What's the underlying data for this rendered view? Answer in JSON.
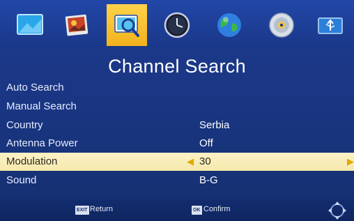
{
  "iconbar": {
    "tabs": [
      {
        "icon": "picture-icon"
      },
      {
        "icon": "photo-icon"
      },
      {
        "icon": "channel-search-icon",
        "active": true
      },
      {
        "icon": "clock-icon"
      },
      {
        "icon": "globe-icon"
      },
      {
        "icon": "disc-icon"
      },
      {
        "icon": "usb-icon"
      }
    ]
  },
  "page": {
    "title": "Channel Search"
  },
  "menu": {
    "items": [
      {
        "label": "Auto Search",
        "value": ""
      },
      {
        "label": "Manual Search",
        "value": ""
      },
      {
        "label": "Country",
        "value": "Serbia"
      },
      {
        "label": "Antenna Power",
        "value": "Off"
      },
      {
        "label": "Modulation",
        "value": "30",
        "selected": true
      },
      {
        "label": "Sound",
        "value": "B-G"
      }
    ]
  },
  "footer": {
    "return_key": "EXIT",
    "return_label": "Return",
    "confirm_key": "OK",
    "confirm_label": "Confirm"
  },
  "colors": {
    "background": "#1a3683",
    "active_tab": "#f2b21c",
    "selected_row": "#f6e9ad",
    "arrow": "#e2a900"
  }
}
